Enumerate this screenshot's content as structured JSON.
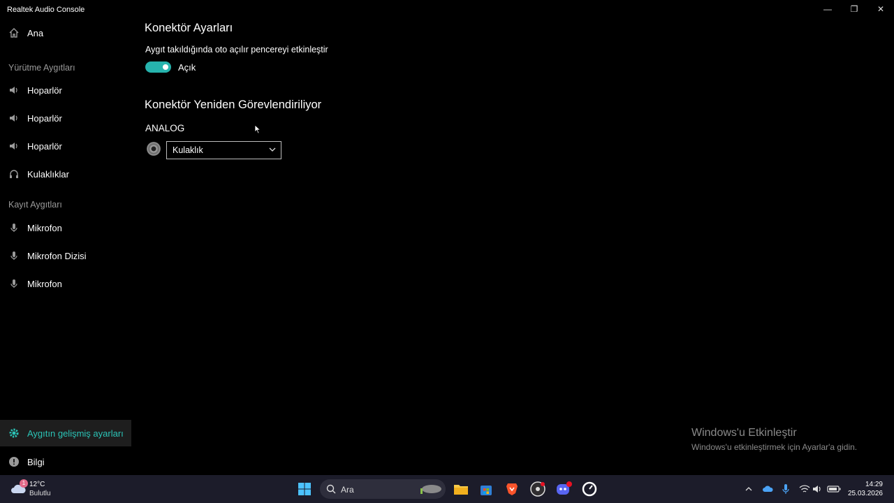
{
  "window": {
    "title": "Realtek Audio Console",
    "minimize": "—",
    "maximize": "❐",
    "close": "✕"
  },
  "sidebar": {
    "home": "Ana",
    "playback_header": "Yürütme Aygıtları",
    "playback": [
      "Hoparlör",
      "Hoparlör",
      "Hoparlör",
      "Kulaklıklar"
    ],
    "recording_header": "Kayıt Aygıtları",
    "recording": [
      "Mikrofon",
      "Mikrofon Dizisi",
      "Mikrofon"
    ],
    "advanced": "Aygıtın gelişmiş ayarları",
    "info": "Bilgi"
  },
  "main": {
    "connector_settings_title": "Konektör Ayarları",
    "popup_label": "Aygıt takıldığında oto açılır pencereyi etkinleştir",
    "toggle_state": "Açık",
    "retasking_title": "Konektör Yeniden Görevlendiriliyor",
    "analog_label": "ANALOG",
    "jack_selection": "Kulaklık"
  },
  "watermark": {
    "title": "Windows'u Etkinleştir",
    "subtitle": "Windows'u etkinleştirmek için Ayarlar'a gidin."
  },
  "taskbar": {
    "weather_temp": "12°C",
    "weather_cond": "Bulutlu",
    "weather_badge": "1",
    "search_placeholder": "Ara",
    "time": "14:29",
    "date": "25.03.2026"
  },
  "colors": {
    "accent": "#2bc4b7",
    "toggle": "#26b3ad",
    "taskbar": "#1c1c2a"
  }
}
